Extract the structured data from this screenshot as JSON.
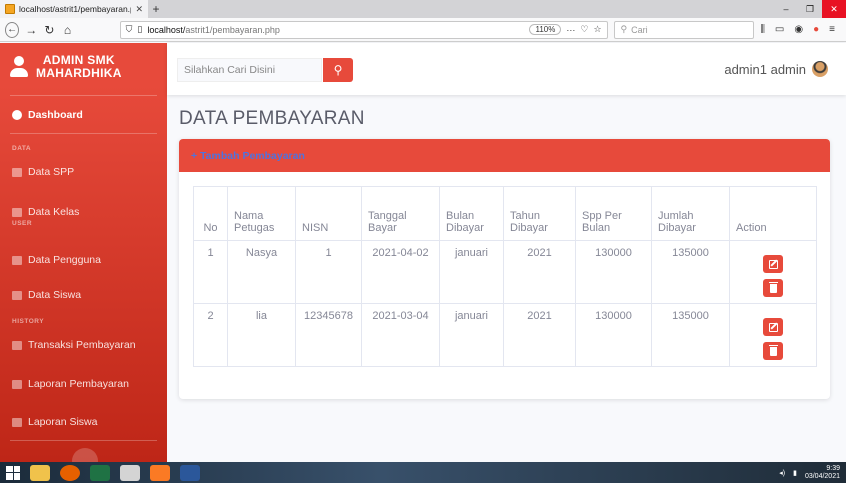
{
  "browser": {
    "tab_title": "localhost/astrit1/pembayaran.p",
    "tab_close": "✕",
    "new_tab": "+",
    "url_host": "localhost/",
    "url_path": "astrit1/pembayaran.php",
    "zoom": "110%",
    "search_placeholder": "Cari"
  },
  "sidebar": {
    "brand_line1": "ADMIN SMK",
    "brand_line2": "MAHARDHIKA",
    "dashboard": "Dashboard",
    "heading_data": "DATA",
    "data_spp": "Data SPP",
    "data_kelas": "Data Kelas",
    "heading_user": "USER",
    "data_pengguna": "Data Pengguna",
    "data_siswa": "Data Siswa",
    "heading_history": "HISTORY",
    "transaksi": "Transaksi Pembayaran",
    "laporan_pembayaran": "Laporan Pembayaran",
    "laporan_siswa": "Laporan Siswa"
  },
  "topbar": {
    "search_placeholder": "Silahkan Cari Disini",
    "username": "admin1 admin"
  },
  "page": {
    "title": "DATA PEMBAYARAN",
    "add_link": "+ Tambah Pembayaran"
  },
  "table": {
    "headers": [
      "No",
      "Nama Petugas",
      "NISN",
      "Tanggal Bayar",
      "Bulan Dibayar",
      "Tahun Dibayar",
      "Spp Per Bulan",
      "Jumlah Dibayar",
      "Action"
    ],
    "rows": [
      [
        "1",
        "Nasya",
        "1",
        "2021-04-02",
        "januari",
        "2021",
        "130000",
        "135000"
      ],
      [
        "2",
        "lia",
        "12345678",
        "2021-03-04",
        "januari",
        "2021",
        "130000",
        "135000"
      ]
    ]
  },
  "taskbar": {
    "time": "9:39",
    "date": "03/04/2021"
  },
  "colors": {
    "accent": "#e74a3b",
    "link": "#4e73df",
    "text_muted": "#858796"
  }
}
